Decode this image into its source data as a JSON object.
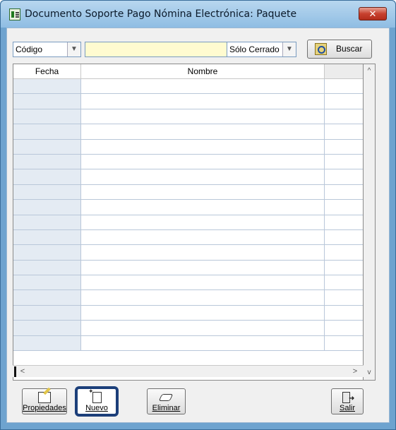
{
  "window": {
    "title": "Documento Soporte Pago Nómina Electrónica: Paquete",
    "close_label": "✕"
  },
  "toolbar": {
    "field_select": "Código",
    "search_value": "",
    "filter_select": "Sólo Cerrado",
    "search_button": "Buscar"
  },
  "grid": {
    "columns": [
      "Fecha",
      "Nombre",
      ""
    ],
    "empty_row_count": 18
  },
  "scroll": {
    "up": "^",
    "down": "v",
    "left": "<",
    "right": ">"
  },
  "buttons": {
    "properties": "Propiedades",
    "new": "Nuevo",
    "delete": "Eliminar",
    "exit": "Salir"
  },
  "icons": {
    "app": "payroll-document-icon",
    "search": "search-icon",
    "properties": "edit-properties-icon",
    "new": "new-document-icon",
    "delete": "eraser-icon",
    "exit": "exit-door-icon"
  },
  "colors": {
    "titlebar": "#8fbde3",
    "close": "#c7402e",
    "search_field": "#fffbd0",
    "active_button_border": "#1c3f7a"
  }
}
